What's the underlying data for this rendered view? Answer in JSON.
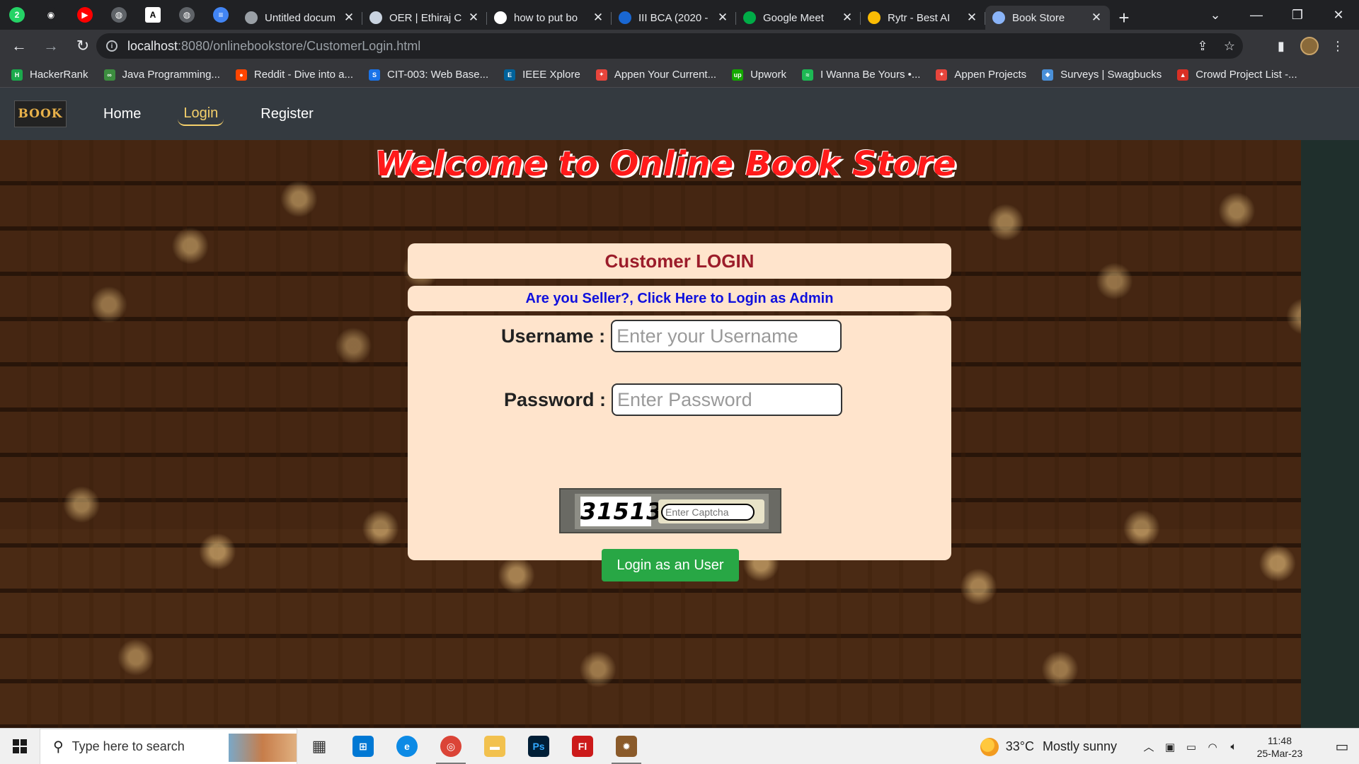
{
  "browser": {
    "pinned_tabs": [
      {
        "icon": "whatsapp-icon",
        "color": "#25d366",
        "glyph": "2"
      },
      {
        "icon": "github-icon",
        "color": "#202124",
        "glyph": "◉"
      },
      {
        "icon": "youtube-icon",
        "color": "#ff0000",
        "glyph": "▶"
      },
      {
        "icon": "globe-icon",
        "color": "#5f6368",
        "glyph": "◍"
      },
      {
        "icon": "font-a-icon",
        "color": "#ffffff",
        "glyph": "A"
      },
      {
        "icon": "globe-icon",
        "color": "#5f6368",
        "glyph": "◍"
      },
      {
        "icon": "docs-icon",
        "color": "#4285f4",
        "glyph": "≡"
      }
    ],
    "tabs": [
      {
        "title": "Untitled docum",
        "favicon": "globe-icon",
        "color": "#9aa0a6"
      },
      {
        "title": "OER | Ethiraj C",
        "favicon": "college-icon",
        "color": "#c9d3e0"
      },
      {
        "title": "how to put bo",
        "favicon": "google-icon",
        "color": "#ffffff"
      },
      {
        "title": "III BCA (2020 -",
        "favicon": "classroom-icon",
        "color": "#1967d2"
      },
      {
        "title": "Google Meet",
        "favicon": "meet-icon",
        "color": "#00ac47"
      },
      {
        "title": "Rytr - Best AI",
        "favicon": "rytr-icon",
        "color": "#fbbc04"
      },
      {
        "title": "Book Store",
        "favicon": "bookstore-icon",
        "color": "#8ab4f8",
        "active": true
      }
    ],
    "url_host": "localhost",
    "url_path": ":8080/onlinebookstore/CustomerLogin.html",
    "bookmarks": [
      {
        "label": "HackerRank",
        "icon": "hackerrank-icon",
        "color": "#1ba94c",
        "glyph": "H"
      },
      {
        "label": "Java Programming...",
        "icon": "java-icon",
        "color": "#3c8d3f",
        "glyph": "∞"
      },
      {
        "label": "Reddit - Dive into a...",
        "icon": "reddit-icon",
        "color": "#ff4500",
        "glyph": "●"
      },
      {
        "label": "CIT-003: Web Base...",
        "icon": "s-icon",
        "color": "#1a73e8",
        "glyph": "S"
      },
      {
        "label": "IEEE Xplore",
        "icon": "ieee-icon",
        "color": "#00629b",
        "glyph": "E"
      },
      {
        "label": "Appen Your Current...",
        "icon": "appen-icon",
        "color": "#e8453c",
        "glyph": "✦"
      },
      {
        "label": "Upwork",
        "icon": "upwork-icon",
        "color": "#14a800",
        "glyph": "up"
      },
      {
        "label": "I Wanna Be Yours •...",
        "icon": "spotify-icon",
        "color": "#1db954",
        "glyph": "≈"
      },
      {
        "label": "Appen Projects",
        "icon": "appen-icon",
        "color": "#e8453c",
        "glyph": "✦"
      },
      {
        "label": "Surveys | Swagbucks",
        "icon": "swagbucks-icon",
        "color": "#4a90d9",
        "glyph": "◆"
      },
      {
        "label": "Crowd Project List -...",
        "icon": "crowd-icon",
        "color": "#d93025",
        "glyph": "▲"
      }
    ]
  },
  "site": {
    "brand": "BOOK",
    "nav": [
      {
        "label": "Home",
        "active": false
      },
      {
        "label": "Login",
        "active": true
      },
      {
        "label": "Register",
        "active": false
      }
    ],
    "welcome": "Welcome to Online Book Store",
    "login_title": "Customer LOGIN",
    "admin_link": "Are you Seller?, Click Here to Login as Admin",
    "username_label": "Username :",
    "username_placeholder": "Enter your Username",
    "password_label": "Password :",
    "password_placeholder": "Enter Password",
    "captcha_code": "31513",
    "captcha_placeholder": "Enter Captcha",
    "login_button": "Login as an User"
  },
  "taskbar": {
    "search_placeholder": "Type here to search",
    "apps": [
      {
        "name": "task-view-icon",
        "color": "#555555",
        "glyph": "▦"
      },
      {
        "name": "store-icon",
        "color": "#0078d4",
        "glyph": "⊞"
      },
      {
        "name": "edge-icon",
        "color": "#0c8ae5",
        "glyph": "e"
      },
      {
        "name": "chrome-icon",
        "color": "#db4437",
        "glyph": "◎",
        "open": true
      },
      {
        "name": "file-explorer-icon",
        "color": "#f2c14e",
        "glyph": "▬"
      },
      {
        "name": "photoshop-icon",
        "color": "#001e36",
        "glyph": "Ps"
      },
      {
        "name": "flash-icon",
        "color": "#cc1a1a",
        "glyph": "Fl"
      },
      {
        "name": "app-icon",
        "color": "#8a5a2a",
        "glyph": "✹",
        "open": true
      }
    ],
    "weather_temp": "33°C",
    "weather_desc": "Mostly sunny",
    "time": "11:48",
    "date": "25-Mar-23"
  }
}
